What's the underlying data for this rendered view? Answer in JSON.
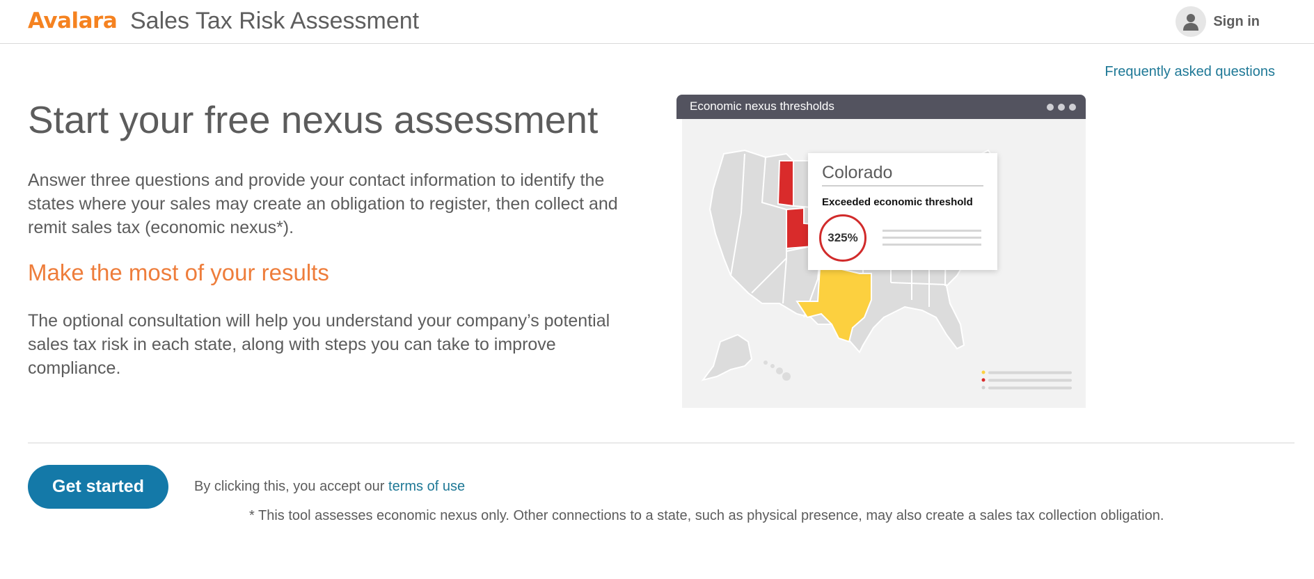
{
  "header": {
    "logo_text": "Avalara",
    "title": "Sales Tax Risk Assessment",
    "signin_label": "Sign in"
  },
  "faq_link": "Frequently asked questions",
  "hero": {
    "title": "Start your free nexus assessment",
    "intro": "Answer three questions and provide your contact information to identify the states where your sales may create an obligation to register, then collect and remit sales tax (economic nexus*).",
    "subhead": "Make the most of your results",
    "body": "The optional consultation will help you understand your company’s potential sales tax risk in each state, along with steps you can take to improve compliance."
  },
  "illustration": {
    "window_title": "Economic nexus thresholds",
    "popup": {
      "state": "Colorado",
      "status": "Exceeded economic threshold",
      "percent": "325%"
    },
    "colors": {
      "exceeded": "#d92b2b",
      "approaching": "#fcd03f",
      "neutral": "#dcdcdc"
    }
  },
  "cta": {
    "button_label": "Get started",
    "terms_prefix": "By clicking this, you accept our",
    "terms_link": "terms of use",
    "footnote": "* This tool assesses economic nexus only. Other connections to a state, such as physical presence, may also create a sales tax collection obligation."
  },
  "colors": {
    "brand_orange": "#f58220",
    "link_blue": "#1e7896",
    "button_blue": "#1479a8"
  }
}
